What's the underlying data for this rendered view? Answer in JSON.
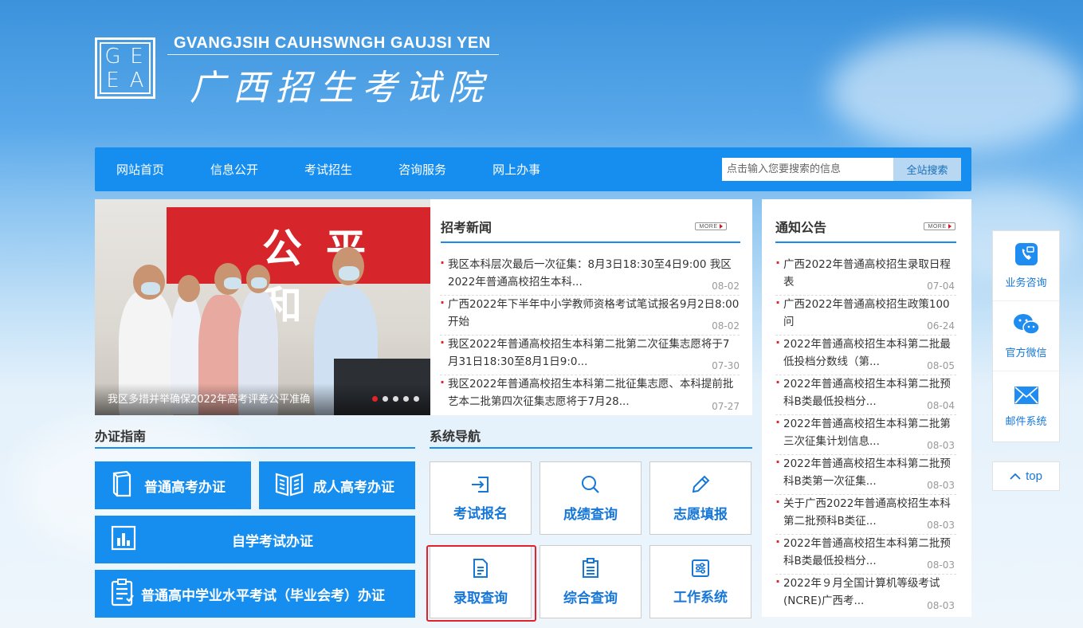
{
  "header": {
    "logo_letters": [
      "G",
      "E",
      "E",
      "A"
    ],
    "title_en": "GVANGJSIH CAUHSWNGH GAUJSI YEN",
    "title_cn": "广西招生考试院"
  },
  "nav": {
    "items": [
      "网站首页",
      "信息公开",
      "考试招生",
      "咨询服务",
      "网上办事"
    ],
    "search_placeholder": "点击输入您要搜索的信息",
    "search_button": "全站搜索"
  },
  "slideshow": {
    "banner_text": "公平 和",
    "caption": "我区多措并举确保2022年高考评卷公平准确",
    "dot_count": 5,
    "active_dot": 0
  },
  "news": {
    "title": "招考新闻",
    "more_label": "MORE",
    "items": [
      {
        "text": "我区本科层次最后一次征集：8月3日18:30至4日9:00 我区2022年普通高校招生本科...",
        "date": "08-02"
      },
      {
        "text": "广西2022年下半年中小学教师资格考试笔试报名9月2日8:00开始",
        "date": "08-02"
      },
      {
        "text": "我区2022年普通高校招生本科第二批第二次征集志愿将于7月31日18:30至8月1日9:0...",
        "date": "07-30"
      },
      {
        "text": "我区2022年普通高校招生本科第二批征集志愿、本科提前批艺本二批第四次征集志愿将于7月28...",
        "date": "07-27"
      }
    ]
  },
  "notice": {
    "title": "通知公告",
    "more_label": "MORE",
    "items": [
      {
        "text": "广西2022年普通高校招生录取日程表",
        "date": "07-04"
      },
      {
        "text": "广西2022年普通高校招生政策100问",
        "date": "06-24"
      },
      {
        "text": "2022年普通高校招生本科第二批最低投档分数线（第...",
        "date": "08-05"
      },
      {
        "text": "2022年普通高校招生本科第二批预科B类最低投档分...",
        "date": "08-04"
      },
      {
        "text": "2022年普通高校招生本科第二批第三次征集计划信息...",
        "date": "08-03"
      },
      {
        "text": "2022年普通高校招生本科第二批预科B类第一次征集...",
        "date": "08-03"
      },
      {
        "text": "关于广西2022年普通高校招生本科第二批预科B类征...",
        "date": "08-03"
      },
      {
        "text": "2022年普通高校招生本科第二批预科B类最低投档分...",
        "date": "08-03"
      },
      {
        "text": "2022年９月全国计算机等级考试(NCRE)广西考...",
        "date": "08-03"
      }
    ]
  },
  "guide": {
    "title": "办证指南",
    "buttons": [
      "普通高考办证",
      "成人高考办证",
      "自学考试办证",
      "普通高中学业水平考试（毕业会考）办证"
    ]
  },
  "sysnav": {
    "title": "系统导航",
    "tiles": [
      "考试报名",
      "成绩查询",
      "志愿填报",
      "录取查询",
      "综合查询",
      "工作系统"
    ]
  },
  "float_bar": {
    "items": [
      "业务咨询",
      "官方微信",
      "邮件系统"
    ],
    "top_label": "top"
  },
  "colors": {
    "primary": "#168ef0",
    "accent_red": "#e3222a",
    "tile_text": "#1677d8"
  }
}
